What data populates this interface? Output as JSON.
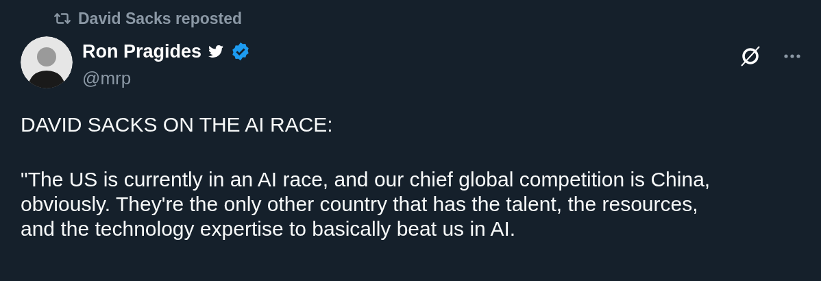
{
  "repost": {
    "label": "David Sacks reposted"
  },
  "author": {
    "name": "Ron Pragides",
    "handle": "@mrp",
    "verified": true
  },
  "body": [
    "DAVID SACKS ON THE AI RACE:",
    "\"The US is currently in an AI race, and our chief global competition is China,\nobviously. They're the only other country that has the talent, the resources,\nand the technology expertise to basically beat us in AI."
  ]
}
